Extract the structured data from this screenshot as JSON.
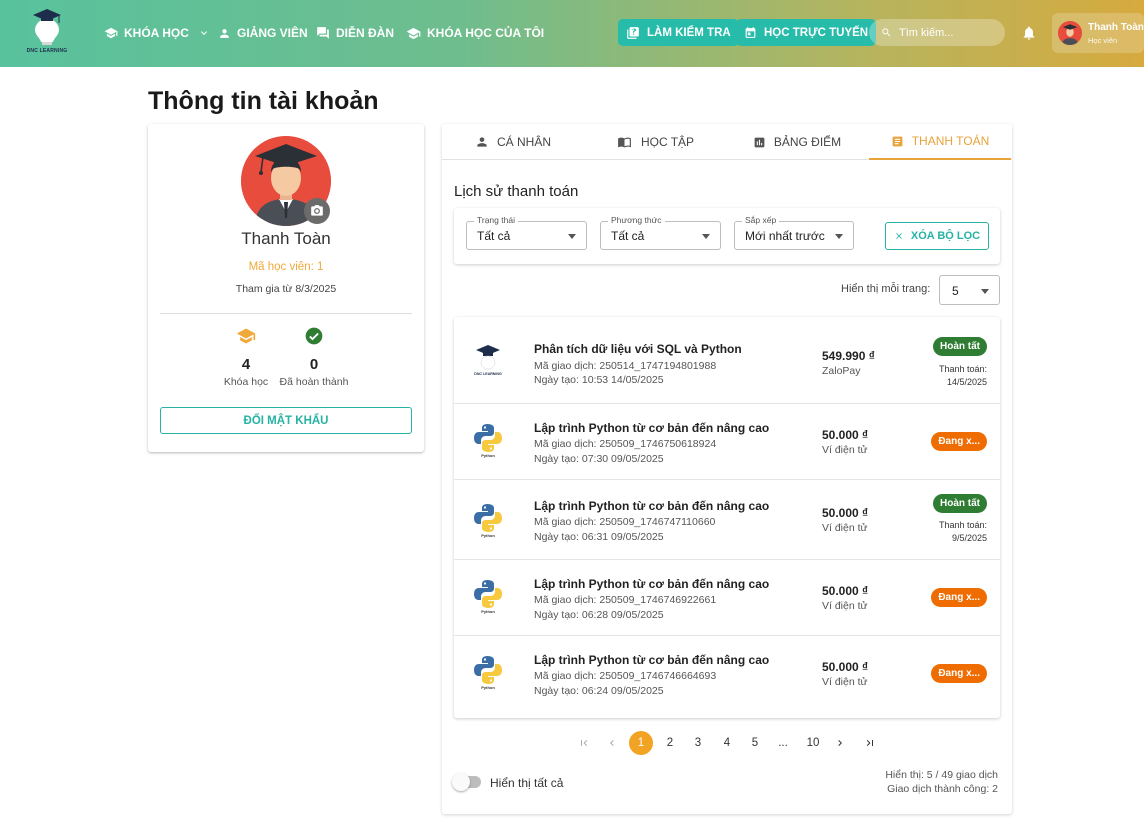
{
  "header": {
    "logo_text": "DNC LEARNING",
    "nav": [
      {
        "label": "KHÓA HỌC",
        "icon": "book-icon"
      },
      {
        "label": "GIẢNG VIÊN",
        "icon": "person-icon"
      },
      {
        "label": "DIỄN ĐÀN",
        "icon": "forum-icon"
      },
      {
        "label": "KHÓA HỌC CỦA TÔI",
        "icon": "school-icon"
      }
    ],
    "test_button": "LÀM KIỂM TRA",
    "online_button": "HỌC TRỰC TUYẾN",
    "search_placeholder": "Tìm kiếm...",
    "user": {
      "name": "Thanh Toàn",
      "role": "Học viên"
    }
  },
  "page_title": "Thông tin tài khoản",
  "profile": {
    "name": "Thanh Toàn",
    "student_id": "Mã học viên: 1",
    "joined": "Tham gia từ 8/3/2025",
    "stats": [
      {
        "value": "4",
        "label": "Khóa học",
        "icon": "school-icon",
        "color": "#f0a93a"
      },
      {
        "value": "0",
        "label": "Đã hoàn thành",
        "icon": "check-circle-icon",
        "color": "#2e7d32"
      }
    ],
    "change_password": "ĐỔI MẬT KHẨU"
  },
  "tabs": [
    {
      "label": "CÁ NHÂN",
      "icon": "person-icon"
    },
    {
      "label": "HỌC TẬP",
      "icon": "book-open-icon"
    },
    {
      "label": "BẢNG ĐIỂM",
      "icon": "chart-icon"
    },
    {
      "label": "THANH TOÁN",
      "icon": "receipt-icon",
      "active": true
    }
  ],
  "section_title": "Lịch sử thanh toán",
  "filters": {
    "status": {
      "label": "Trạng thái",
      "value": "Tất cả"
    },
    "method": {
      "label": "Phương thức",
      "value": "Tất cả"
    },
    "sort": {
      "label": "Sắp xếp",
      "value": "Mới nhất trước"
    },
    "clear": "XÓA BỘ LỌC"
  },
  "per_page": {
    "label": "Hiển thị mỗi trang:",
    "value": "5"
  },
  "transactions": [
    {
      "title": "Phân tích dữ liệu với SQL và Python",
      "code": "Mã giao dịch: 250514_1747194801988",
      "created": "Ngày tạo: 10:53 14/05/2025",
      "amount": "549.990 ₫",
      "method": "ZaloPay",
      "status": "Hoàn tất",
      "status_type": "done",
      "paid_label": "Thanh toán:",
      "paid_date": "14/5/2025",
      "thumb": "dnc-logo-icon"
    },
    {
      "title": "Lập trình Python từ cơ bản đến nâng cao",
      "code": "Mã giao dịch: 250509_1746750618924",
      "created": "Ngày tạo: 07:30 09/05/2025",
      "amount": "50.000 ₫",
      "method": "Ví điện tử",
      "status": "Đang x...",
      "status_type": "pending",
      "thumb": "python-logo-icon"
    },
    {
      "title": "Lập trình Python từ cơ bản đến nâng cao",
      "code": "Mã giao dịch: 250509_1746747110660",
      "created": "Ngày tạo: 06:31 09/05/2025",
      "amount": "50.000 ₫",
      "method": "Ví điện tử",
      "status": "Hoàn tất",
      "status_type": "done",
      "paid_label": "Thanh toán:",
      "paid_date": "9/5/2025",
      "thumb": "python-logo-icon"
    },
    {
      "title": "Lập trình Python từ cơ bản đến nâng cao",
      "code": "Mã giao dịch: 250509_1746746922661",
      "created": "Ngày tạo: 06:28 09/05/2025",
      "amount": "50.000 ₫",
      "method": "Ví điện tử",
      "status": "Đang x...",
      "status_type": "pending",
      "thumb": "python-logo-icon"
    },
    {
      "title": "Lập trình Python từ cơ bản đến nâng cao",
      "code": "Mã giao dịch: 250509_1746746664693",
      "created": "Ngày tạo: 06:24 09/05/2025",
      "amount": "50.000 ₫",
      "method": "Ví điện tử",
      "status": "Đang x...",
      "status_type": "pending",
      "thumb": "python-logo-icon"
    }
  ],
  "pagination": {
    "pages": [
      "1",
      "2",
      "3",
      "4",
      "5",
      "...",
      "10"
    ],
    "current": "1"
  },
  "show_all": {
    "label": "Hiển thị tất cả",
    "on": false
  },
  "summary": {
    "shown": "Hiển thị: 5 / 49 giao dịch",
    "success": "Giao dịch thành công: 2"
  },
  "colors": {
    "accent": "#26b2a5",
    "active_tab": "#e8a33a",
    "done": "#2e7d32",
    "pending": "#ef6c00"
  }
}
